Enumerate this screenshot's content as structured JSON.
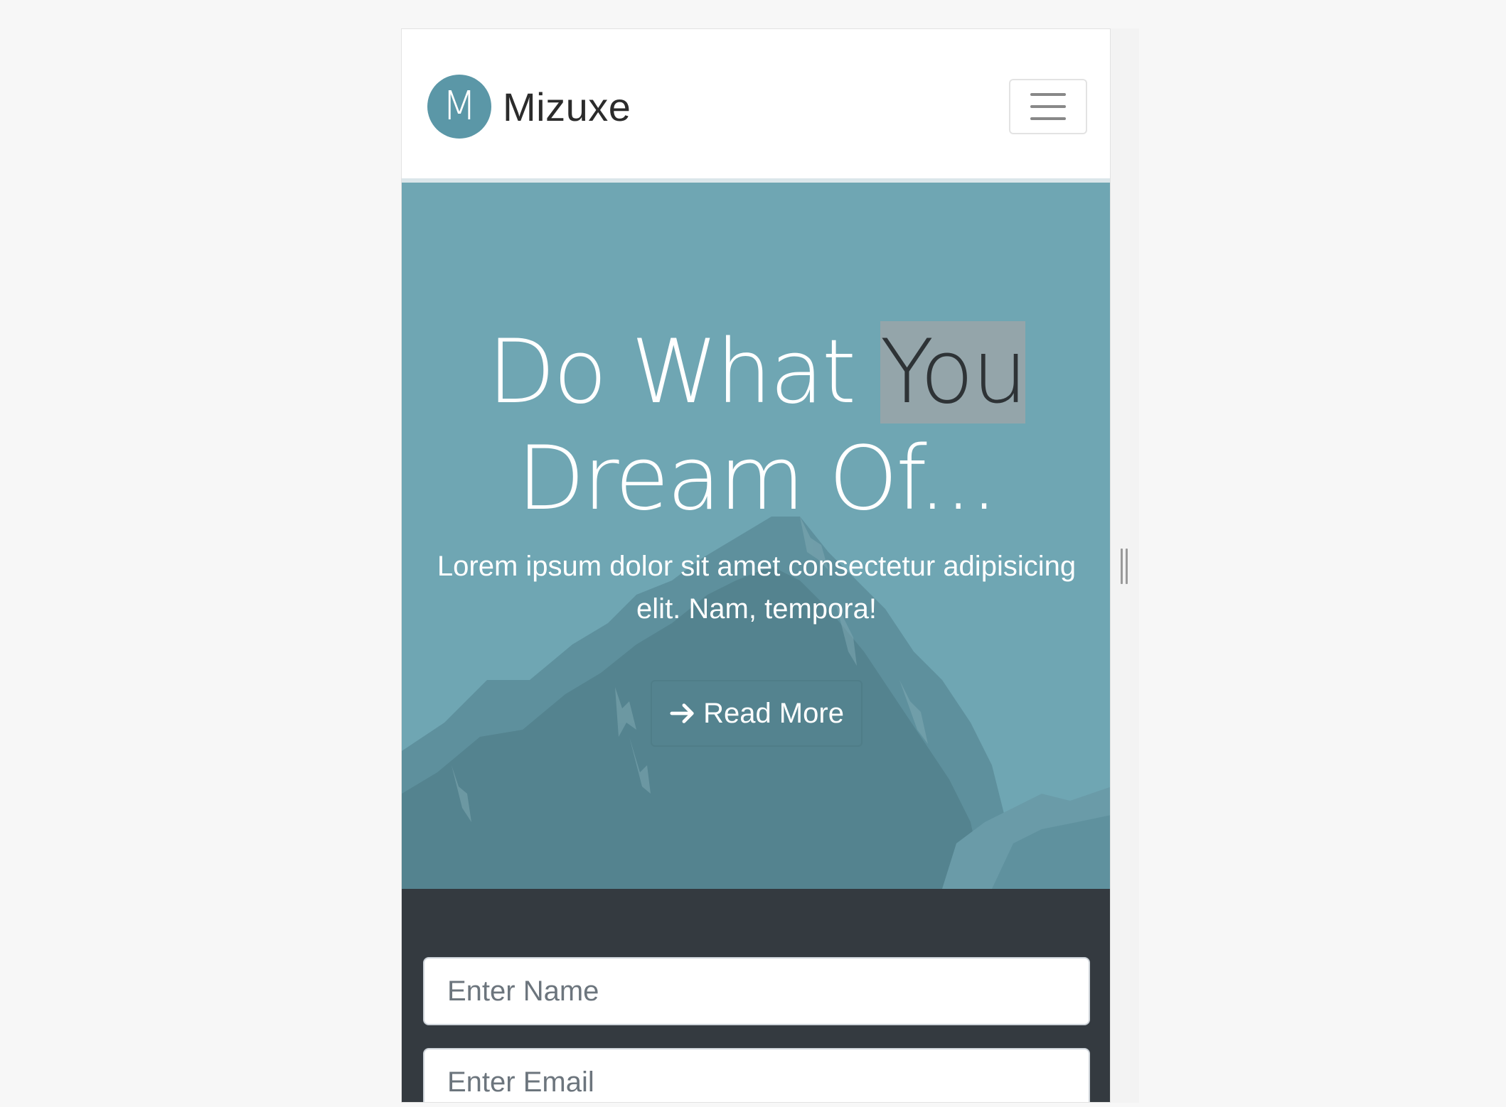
{
  "navbar": {
    "logo_letter": "M",
    "brand_name": "Mizuxe",
    "menu_icon": "hamburger-menu-icon"
  },
  "hero": {
    "title_part1": "Do What ",
    "title_highlight": "You",
    "title_part2": "Dream Of...",
    "subtitle": "Lorem ipsum dolor sit amet consectetur adipisicing elit. Nam, tempora!",
    "button_icon": "arrow-right-icon",
    "button_label": "Read More",
    "background_color": "#6fa6b3",
    "highlight_color": "#94a5aa"
  },
  "signup": {
    "name_placeholder": "Enter Name",
    "email_placeholder": "Enter Email",
    "background_color": "#343a40"
  },
  "colors": {
    "brand": "#5b97a7",
    "page_background": "#f7f7f7"
  }
}
